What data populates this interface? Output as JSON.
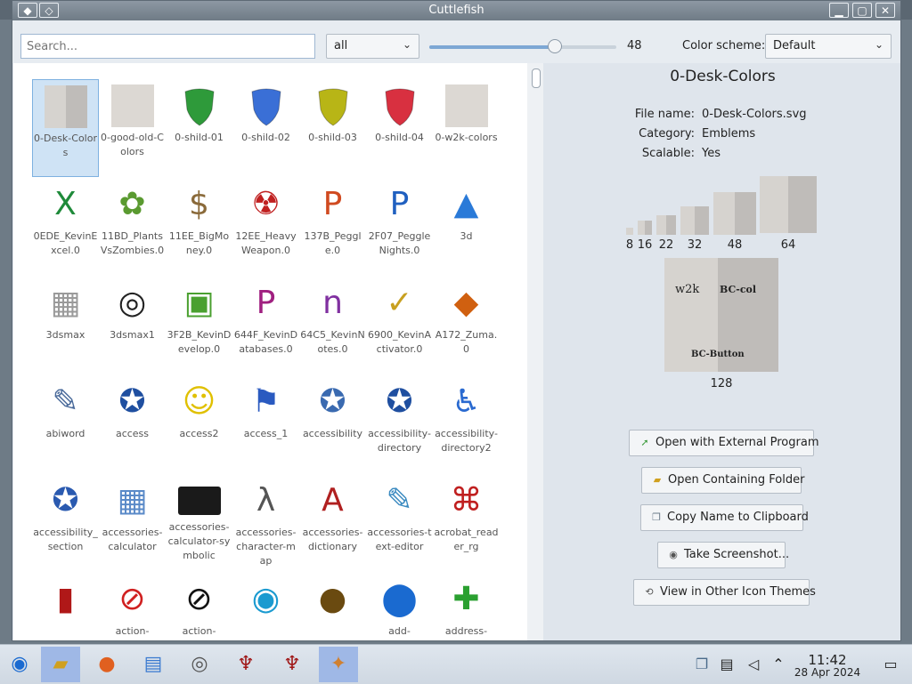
{
  "window": {
    "title": "Cuttlefish",
    "minimize": "▁",
    "maximize": "▢",
    "close": "✕"
  },
  "toolbar": {
    "search_placeholder": "Search...",
    "category_value": "all",
    "size_value": "48",
    "size_fraction": 0.67,
    "color_scheme_label": "Color scheme:",
    "color_scheme_value": "Default"
  },
  "icons": [
    {
      "label": "0-Desk-Colors",
      "kind": "w2k",
      "selected": true
    },
    {
      "label": "0-good-old-Colors",
      "kind": "grey"
    },
    {
      "label": "0-shild-01",
      "kind": "shield",
      "color": "#2e9a3a"
    },
    {
      "label": "0-shild-02",
      "kind": "shield",
      "color": "#3a6fd6"
    },
    {
      "label": "0-shild-03",
      "kind": "shield",
      "color": "#b8b516"
    },
    {
      "label": "0-shild-04",
      "kind": "shield",
      "color": "#d83040"
    },
    {
      "label": "0-w2k-colors",
      "kind": "grey"
    },
    {
      "label": "0EDE_KevinExcel.0",
      "kind": "glyph",
      "glyph": "X",
      "color": "#1f8a3a"
    },
    {
      "label": "11BD_PlantsVsZombies.0",
      "kind": "glyph",
      "glyph": "✿",
      "color": "#5a9a30"
    },
    {
      "label": "11EE_BigMoney.0",
      "kind": "glyph",
      "glyph": "$",
      "color": "#8a6a3a"
    },
    {
      "label": "12EE_HeavyWeapon.0",
      "kind": "glyph",
      "glyph": "☢",
      "color": "#c02020"
    },
    {
      "label": "137B_Peggle.0",
      "kind": "glyph",
      "glyph": "P",
      "color": "#d04a20"
    },
    {
      "label": "2F07_PeggleNights.0",
      "kind": "glyph",
      "glyph": "P",
      "color": "#2060c0"
    },
    {
      "label": "3d",
      "kind": "glyph",
      "glyph": "▲",
      "color": "#2a7ad8"
    },
    {
      "label": "3dsmax",
      "kind": "glyph",
      "glyph": "▦",
      "color": "#9a9a9a"
    },
    {
      "label": "3dsmax1",
      "kind": "glyph",
      "glyph": "◎",
      "color": "#222222"
    },
    {
      "label": "3F2B_KevinDevelop.0",
      "kind": "glyph",
      "glyph": "▣",
      "color": "#4aa030"
    },
    {
      "label": "644F_KevinDatabases.0",
      "kind": "glyph",
      "glyph": "P",
      "color": "#a02080"
    },
    {
      "label": "64C5_KevinNotes.0",
      "kind": "glyph",
      "glyph": "n",
      "color": "#8030a0"
    },
    {
      "label": "6900_KevinActivator.0",
      "kind": "glyph",
      "glyph": "✓",
      "color": "#c8a020"
    },
    {
      "label": "A172_Zuma.0",
      "kind": "glyph",
      "glyph": "◆",
      "color": "#d06010"
    },
    {
      "label": "abiword",
      "kind": "glyph",
      "glyph": "✎",
      "color": "#4a6a9a"
    },
    {
      "label": "access",
      "kind": "glyph",
      "glyph": "✪",
      "color": "#1f4fa0"
    },
    {
      "label": "access2",
      "kind": "glyph",
      "glyph": "☺",
      "color": "#e0c000"
    },
    {
      "label": "access_1",
      "kind": "glyph",
      "glyph": "⚑",
      "color": "#2a5ac0"
    },
    {
      "label": "accessibility",
      "kind": "glyph",
      "glyph": "✪",
      "color": "#3a6ab0"
    },
    {
      "label": "accessibility-directory",
      "kind": "glyph",
      "glyph": "✪",
      "color": "#1f4fa0"
    },
    {
      "label": "accessibility-directory2",
      "kind": "glyph",
      "glyph": "♿",
      "color": "#2a6ad0"
    },
    {
      "label": "accessibility_section",
      "kind": "glyph",
      "glyph": "✪",
      "color": "#2a5ab0"
    },
    {
      "label": "accessories-calculator",
      "kind": "glyph",
      "glyph": "▦",
      "color": "#5a8ac8"
    },
    {
      "label": "accessories-calculator-symbolic",
      "kind": "black"
    },
    {
      "label": "accessories-character-map",
      "kind": "glyph",
      "glyph": "λ",
      "color": "#555555"
    },
    {
      "label": "accessories-dictionary",
      "kind": "glyph",
      "glyph": "A",
      "color": "#b02020"
    },
    {
      "label": "accessories-text-editor",
      "kind": "glyph",
      "glyph": "✎",
      "color": "#3a8ac0"
    },
    {
      "label": "acrobat_reader_rg",
      "kind": "glyph",
      "glyph": "⌘",
      "color": "#c02020"
    },
    {
      "label": "",
      "kind": "glyph",
      "glyph": "▮",
      "color": "#b01818"
    },
    {
      "label": "action-",
      "kind": "glyph",
      "glyph": "⊘",
      "color": "#d02020"
    },
    {
      "label": "action-",
      "kind": "glyph",
      "glyph": "⊘",
      "color": "#111111"
    },
    {
      "label": "",
      "kind": "glyph",
      "glyph": "◉",
      "color": "#1a9ad0"
    },
    {
      "label": "",
      "kind": "glyph",
      "glyph": "●",
      "color": "#6a4a10"
    },
    {
      "label": "add-",
      "kind": "glyph",
      "glyph": "⬤",
      "color": "#1a6ad0"
    },
    {
      "label": "address-",
      "kind": "glyph",
      "glyph": "✚",
      "color": "#2aa030"
    }
  ],
  "detail": {
    "name": "0-Desk-Colors",
    "file_name_key": "File name:",
    "file_name_value": "0-Desk-Colors.svg",
    "category_key": "Category:",
    "category_value": "Emblems",
    "scalable_key": "Scalable:",
    "scalable_value": "Yes",
    "sizes": [
      "8",
      "16",
      "22",
      "32",
      "48",
      "64",
      "128"
    ],
    "preview_text_left": "w2k",
    "preview_text_right": "BC-col",
    "preview_text_bottom": "BC-Button",
    "buttons": {
      "open_external": "Open with External Program",
      "open_folder": "Open Containing Folder",
      "copy_name": "Copy Name to Clipboard",
      "screenshot": "Take Screenshot...",
      "other_themes": "View in Other Icon Themes"
    }
  },
  "taskbar": {
    "time": "11:42",
    "date": "28 Apr 2024"
  }
}
